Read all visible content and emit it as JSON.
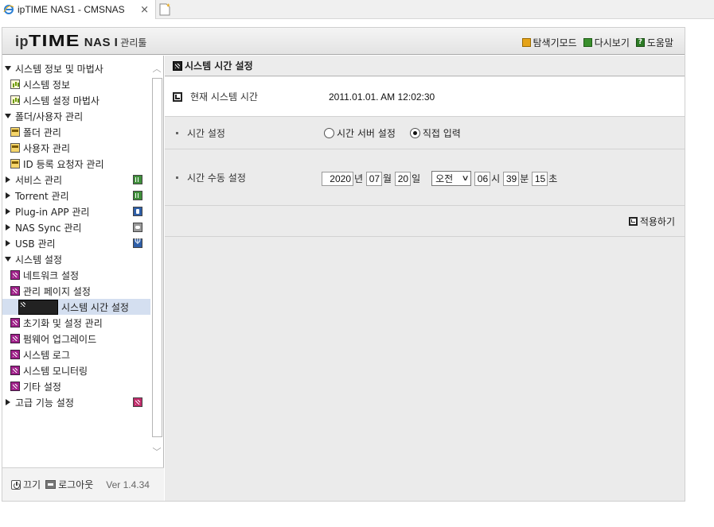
{
  "browser": {
    "tab_title": "ipTIME NAS1 - CMSNAS",
    "close_glyph": "×"
  },
  "header": {
    "logo_ip": "ip",
    "logo_time": "TIME",
    "logo_nas": "NAS I",
    "logo_suffix": "관리툴",
    "links": [
      {
        "label": "탐색기모드",
        "icon": "explorer-icon"
      },
      {
        "label": "다시보기",
        "icon": "refresh-icon"
      },
      {
        "label": "도움말",
        "icon": "help-icon"
      }
    ]
  },
  "sidebar": {
    "items": [
      {
        "label": "시스템 정보 및 마법사",
        "level": 0,
        "expanded": true
      },
      {
        "label": "시스템 정보",
        "level": 1,
        "icon": "chart-icon"
      },
      {
        "label": "시스템 설정 마법사",
        "level": 1,
        "icon": "chart-icon"
      },
      {
        "label": "폴더/사용자 관리",
        "level": 0,
        "expanded": true
      },
      {
        "label": "폴더 관리",
        "level": 1,
        "icon": "folder-icon"
      },
      {
        "label": "사용자 관리",
        "level": 1,
        "icon": "folder-icon"
      },
      {
        "label": "ID 등록 요청자 관리",
        "level": 1,
        "icon": "folder-icon"
      },
      {
        "label": "서비스 관리",
        "level": 0,
        "expanded": false,
        "right_icon": "service-icon"
      },
      {
        "label": "Torrent 관리",
        "level": 0,
        "expanded": false,
        "right_icon": "torrent-icon"
      },
      {
        "label": "Plug-in APP 관리",
        "level": 0,
        "expanded": false,
        "right_icon": "plugin-icon"
      },
      {
        "label": "NAS Sync 관리",
        "level": 0,
        "expanded": false,
        "right_icon": "sync-icon"
      },
      {
        "label": "USB 관리",
        "level": 0,
        "expanded": false,
        "right_icon": "usb-icon"
      },
      {
        "label": "시스템 설정",
        "level": 0,
        "expanded": true
      },
      {
        "label": "네트워크 설정",
        "level": 1,
        "icon": "system-icon"
      },
      {
        "label": "관리 페이지 설정",
        "level": 1,
        "icon": "system-icon"
      },
      {
        "label": "시스템 시간 설정",
        "level": 1,
        "icon": "system-icon",
        "selected": true
      },
      {
        "label": "초기화 및 설정 관리",
        "level": 1,
        "icon": "system-icon"
      },
      {
        "label": "펌웨어 업그레이드",
        "level": 1,
        "icon": "system-icon"
      },
      {
        "label": "시스템 로그",
        "level": 1,
        "icon": "system-icon"
      },
      {
        "label": "시스템 모니터링",
        "level": 1,
        "icon": "system-icon"
      },
      {
        "label": "기타 설정",
        "level": 1,
        "icon": "system-icon"
      },
      {
        "label": "고급 기능 설정",
        "level": 0,
        "expanded": false,
        "right_icon": "advanced-icon"
      }
    ],
    "footer": {
      "power_label": "끄기",
      "logout_label": "로그아웃",
      "version": "Ver 1.4.34"
    }
  },
  "main": {
    "title": "시스템 시간 설정",
    "current_time_label": "현재 시스템 시간",
    "current_time_value": "2011.01.01. AM 12:02:30",
    "mode_label": "시간 설정",
    "mode_options": [
      {
        "label": "시간 서버 설정",
        "selected": false
      },
      {
        "label": "직접 입력",
        "selected": true
      }
    ],
    "manual_label": "시간 수동 설정",
    "manual": {
      "year": "2020",
      "year_unit": "년",
      "month": "07",
      "month_unit": "월",
      "day": "20",
      "day_unit": "일",
      "ampm": "오전",
      "hour": "06",
      "hour_unit": "시",
      "minute": "39",
      "minute_unit": "분",
      "second": "15",
      "second_unit": "초"
    },
    "apply_label": "적용하기"
  }
}
